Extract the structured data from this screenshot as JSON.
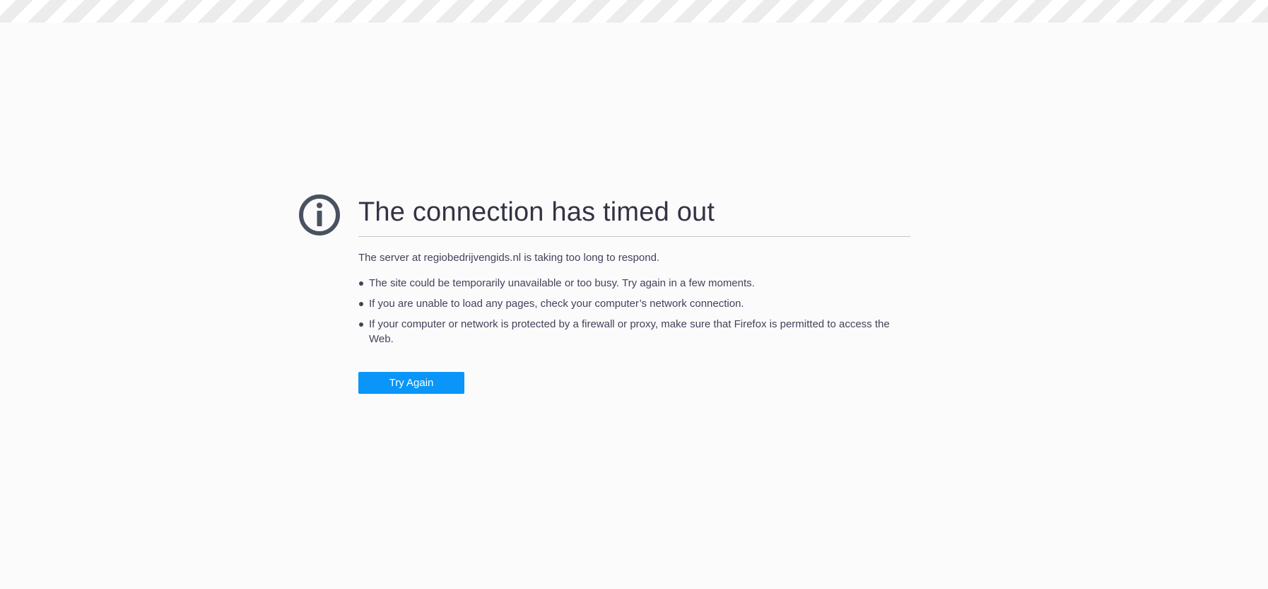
{
  "error": {
    "title": "The connection has timed out",
    "description": "The server at regiobedrijvengids.nl is taking too long to respond.",
    "suggestions": [
      "The site could be temporarily unavailable or too busy. Try again in a few moments.",
      "If you are unable to load any pages, check your computer’s network connection.",
      "If your computer or network is protected by a firewall or proxy, make sure that Firefox is permitted to access the Web."
    ],
    "icon": "info-icon"
  },
  "actions": {
    "try_again_label": "Try Again"
  },
  "colors": {
    "background": "#fbfbfc",
    "text": "#42425a",
    "title": "#333344",
    "button": "#0996f8",
    "icon": "#4a5161"
  }
}
